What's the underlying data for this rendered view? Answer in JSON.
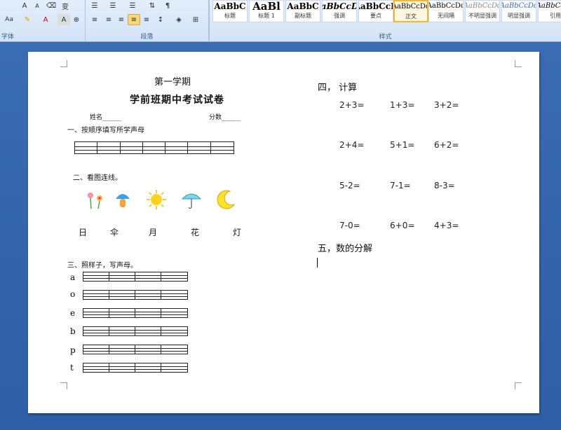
{
  "ribbon": {
    "font_group_label": "字体",
    "paragraph_group_label": "段落",
    "styles_group_label": "样式",
    "styles": [
      {
        "sample": "AaBbC",
        "name": "标题"
      },
      {
        "sample": "AaBl",
        "name": "标题 1"
      },
      {
        "sample": "AaBbC",
        "name": "副标题"
      },
      {
        "sample": "AaBbCcDd",
        "name": "强调"
      },
      {
        "sample": "AaBbCcD",
        "name": "要点"
      },
      {
        "sample": "AaBbCcDd",
        "name": "正文",
        "selected": true
      },
      {
        "sample": "AaBbCcDd",
        "name": "无间隔"
      },
      {
        "sample": "AaBbCcDd",
        "name": "不明显强调"
      },
      {
        "sample": "AaBbCcDd",
        "name": "明显强调"
      },
      {
        "sample": "AaBbCcDd",
        "name": "引用"
      }
    ]
  },
  "document": {
    "term": "第一学期",
    "title": "学前班期中考试试卷",
    "name_field": "姓名______",
    "score_field": "分数______",
    "section1": "一、按顺序填写所学声母",
    "section2": "二、看图连线。",
    "pictures": [
      "flower-icon",
      "mushroom-lamp-icon",
      "sun-icon",
      "umbrella-icon",
      "moon-icon"
    ],
    "characters": [
      "日",
      "伞",
      "月",
      "花",
      "灯"
    ],
    "section3": "三、照样子，写声母。",
    "pinyin_letters": [
      "a",
      "o",
      "e",
      "b",
      "p",
      "t"
    ],
    "section4": "四，  计算",
    "calc_rows": [
      [
        "2+3=",
        "1+3=",
        "3+2="
      ],
      [
        "2+4=",
        "5+1=",
        "6+2="
      ],
      [
        "5-2=",
        "7-1=",
        "8-3="
      ],
      [
        "7-0=",
        "6+0=",
        "4+3="
      ]
    ],
    "section5": "五，数的分解"
  }
}
